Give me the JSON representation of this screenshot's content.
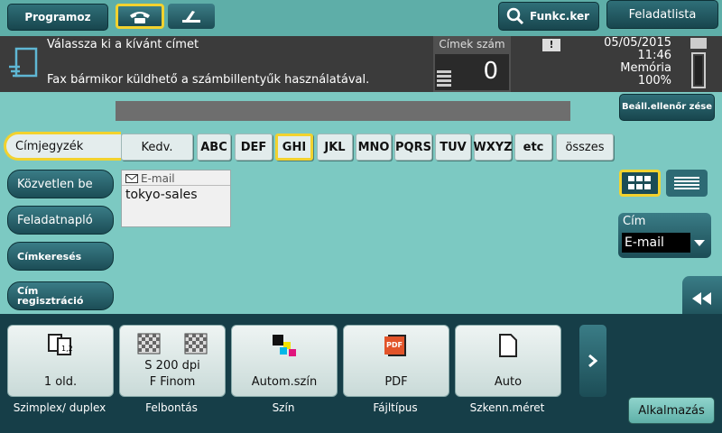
{
  "top": {
    "programs_label": "Programoz",
    "func_search_label": "Funkc.ker",
    "job_list_label": "Feladatlista"
  },
  "message": {
    "line1": "Válassza ki a kívánt címet",
    "line2": "Fax bármikor küldhető a számbillentyűk használatával.",
    "address_count_label": "Címek szám",
    "address_count": "0",
    "date": "05/05/2015",
    "time": "11:46",
    "memory_label": "Memória",
    "memory_value": "100%"
  },
  "check_settings_label": "Beáll.ellenőr zése",
  "tabs": [
    {
      "label": "Címjegyzék"
    },
    {
      "label": "Közvetlen be"
    },
    {
      "label": "Feladatnapló"
    },
    {
      "label": "Címkeresés"
    },
    {
      "label": "Cím regisztráció"
    }
  ],
  "alphabet": [
    "Kedv.",
    "ABC",
    "DEF",
    "GHI",
    "JKL",
    "MNO",
    "PQRS",
    "TUV",
    "WXYZ",
    "etc",
    "összes"
  ],
  "list": {
    "type_label": "E-mail",
    "entry": "tokyo-sales"
  },
  "destination": {
    "label": "Cím",
    "value": "E-mail"
  },
  "functions": [
    {
      "value": "1 old.",
      "label": "Szimplex/ duplex"
    },
    {
      "value": "S 200 dpi F Finom",
      "value1": "S 200 dpi",
      "value2": "F Finom",
      "label": "Felbontás"
    },
    {
      "value": "Autom.szín",
      "label": "Szín"
    },
    {
      "value": "PDF",
      "label": "Fájltípus",
      "badge": "PDF"
    },
    {
      "value": "Auto",
      "label": "Szkenn.méret"
    }
  ],
  "apply_label": "Alkalmazás",
  "colors": {
    "accent": "#f2d22e",
    "background": "#7cc9c2",
    "dark_band": "#163e48"
  }
}
